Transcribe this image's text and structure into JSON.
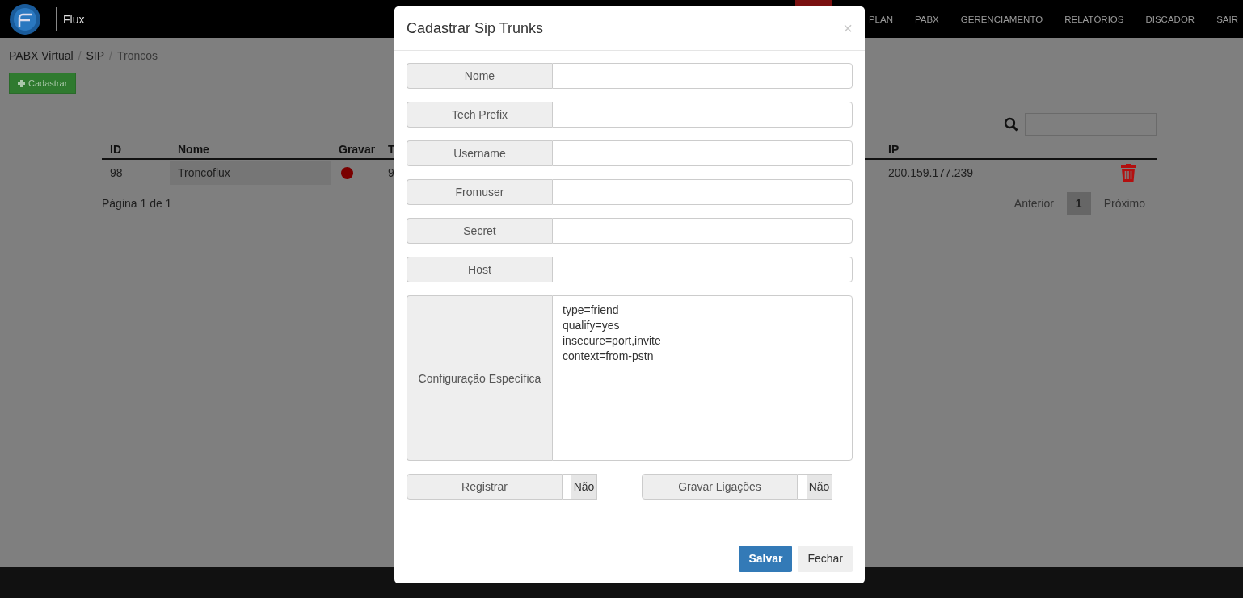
{
  "app": {
    "name": "Flux"
  },
  "nav": [
    {
      "label": "PLAN"
    },
    {
      "label": "PABX"
    },
    {
      "label": "GERENCIAMENTO"
    },
    {
      "label": "RELATÓRIOS"
    },
    {
      "label": "DISCADOR"
    },
    {
      "label": "SAIR"
    }
  ],
  "breadcrumb": [
    {
      "label": "PABX Virtual"
    },
    {
      "separator": "/",
      "label": "SIP"
    },
    {
      "separator": "/",
      "label": "Troncos"
    }
  ],
  "add_button": {
    "label": "Cadastrar"
  },
  "table": {
    "columns": [
      "ID",
      "Nome",
      "Gravar",
      "T",
      "IP"
    ],
    "rows": [
      {
        "id": "98",
        "nome": "Troncoflux",
        "gravar": false,
        "column_4": "9",
        "ip": "200.159.177.239"
      }
    ]
  },
  "pagination": {
    "info": "Página 1 de 1",
    "previous": "Anterior",
    "pages": [
      {
        "label": "1",
        "selected": true
      }
    ],
    "next": "Próximo"
  },
  "modal": {
    "title": "Cadastrar Sip Trunks",
    "close": "×",
    "fields": [
      {
        "label": "Nome"
      },
      {
        "label": "Tech Prefix"
      },
      {
        "label": "Username"
      },
      {
        "label": "Fromuser"
      },
      {
        "label": "Secret"
      },
      {
        "label": "Host"
      }
    ],
    "config": {
      "label": "Configuração Específica",
      "value": "type=friend\nqualify=yes\ninsecure=port,invite\ncontext=from-pstn"
    },
    "toggles": [
      {
        "label": "Registrar",
        "on": false,
        "text": "Não"
      },
      {
        "label": "Gravar Ligações",
        "on": false,
        "text": "Não"
      }
    ],
    "buttons": [
      {
        "label": "Salvar",
        "kind": "primary"
      },
      {
        "label": "Fechar",
        "kind": "default"
      }
    ]
  }
}
